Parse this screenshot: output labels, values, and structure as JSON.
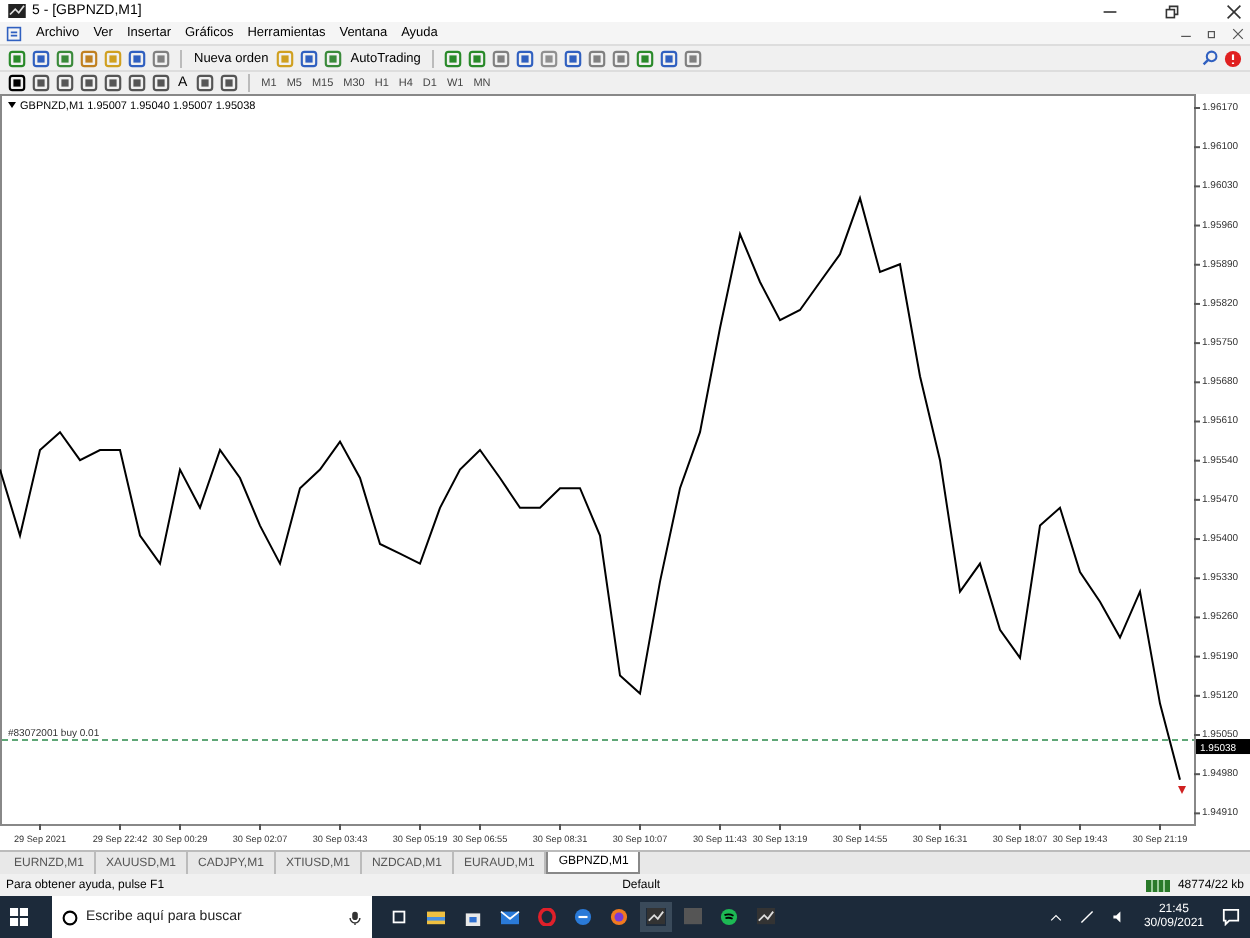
{
  "window": {
    "title": "5 - [GBPNZD,M1]"
  },
  "menu": [
    "Archivo",
    "Ver",
    "Insertar",
    "Gráficos",
    "Herramientas",
    "Ventana",
    "Ayuda"
  ],
  "toolbar": {
    "new_order": "Nueva orden",
    "autotrading": "AutoTrading",
    "text_tool": "A",
    "timeframes": [
      "M1",
      "M5",
      "M15",
      "M30",
      "H1",
      "H4",
      "D1",
      "W1",
      "MN"
    ]
  },
  "chart": {
    "header": "GBPNZD,M1  1.95007 1.95040 1.95007 1.95038",
    "price_label": "1.95038",
    "chart_data": {
      "type": "line",
      "categories": [
        null,
        null,
        "29 Sep 2021",
        null,
        null,
        null,
        "29 Sep 22:42",
        null,
        null,
        "30 Sep 00:29",
        null,
        null,
        null,
        "30 Sep 02:07",
        null,
        null,
        null,
        "30 Sep 03:43",
        null,
        null,
        null,
        "30 Sep 05:19",
        null,
        null,
        "30 Sep 06:55",
        null,
        null,
        null,
        "30 Sep 08:31",
        null,
        null,
        null,
        "30 Sep 10:07",
        null,
        null,
        null,
        "30 Sep 11:43",
        null,
        null,
        "30 Sep 13:19",
        null,
        null,
        null,
        "30 Sep 14:55",
        null,
        null,
        null,
        "30 Sep 16:31",
        null,
        null,
        null,
        "30 Sep 18:07",
        null,
        null,
        "30 Sep 19:43",
        null,
        null,
        null,
        "30 Sep 21:19",
        null
      ],
      "series": [
        {
          "color": "#000000",
          "values": [
            1.95524,
            1.95406,
            1.95559,
            1.95591,
            1.95541,
            1.95559,
            1.95559,
            1.95406,
            1.95356,
            1.95524,
            1.95456,
            1.95559,
            1.95509,
            1.95424,
            1.95356,
            1.95491,
            1.95524,
            1.95574,
            1.95509,
            1.95391,
            1.95374,
            1.95356,
            1.95456,
            1.95524,
            1.95559,
            1.95509,
            1.95456,
            1.95456,
            1.95491,
            1.95491,
            1.95406,
            1.95156,
            1.95124,
            1.95324,
            1.95491,
            1.95591,
            1.95777,
            1.95945,
            1.95859,
            1.95791,
            1.95809,
            1.95859,
            1.95909,
            1.96009,
            1.95877,
            1.95891,
            1.95691,
            1.95541,
            1.95306,
            1.95356,
            1.95238,
            1.95188,
            1.95424,
            1.95456,
            1.95341,
            1.95288,
            1.95224,
            1.95306,
            1.95106,
            1.9497
          ]
        }
      ],
      "ylim": [
        1.94891,
        1.96195
      ],
      "yticks": [
        {
          "value": 1.9617,
          "label": "1.96170"
        },
        {
          "value": 1.961,
          "label": "1.96100"
        },
        {
          "value": 1.9603,
          "label": "1.96030"
        },
        {
          "value": 1.9596,
          "label": "1.95960"
        },
        {
          "value": 1.9589,
          "label": "1.95890"
        },
        {
          "value": 1.9582,
          "label": "1.95820"
        },
        {
          "value": 1.9575,
          "label": "1.95750"
        },
        {
          "value": 1.9568,
          "label": "1.95680"
        },
        {
          "value": 1.9561,
          "label": "1.95610"
        },
        {
          "value": 1.9554,
          "label": "1.95540"
        },
        {
          "value": 1.9547,
          "label": "1.95470"
        },
        {
          "value": 1.954,
          "label": "1.95400"
        },
        {
          "value": 1.9533,
          "label": "1.95330"
        },
        {
          "value": 1.9526,
          "label": "1.95260"
        },
        {
          "value": 1.9519,
          "label": "1.95190"
        },
        {
          "value": 1.9512,
          "label": "1.95120"
        },
        {
          "value": 1.9505,
          "label": "1.95050"
        },
        {
          "value": 1.9498,
          "label": "1.94980"
        },
        {
          "value": 1.9491,
          "label": "1.94910"
        }
      ],
      "ref_lines": [
        {
          "axis": "y",
          "value": 1.95041,
          "label": "#83072001 buy 0.01",
          "color": "#2a8a4a"
        }
      ]
    }
  },
  "tabs": [
    {
      "label": "EURNZD,M1",
      "selected": false
    },
    {
      "label": "XAUUSD,M1",
      "selected": false
    },
    {
      "label": "CADJPY,M1",
      "selected": false
    },
    {
      "label": "XTIUSD,M1",
      "selected": false
    },
    {
      "label": "NZDCAD,M1",
      "selected": false
    },
    {
      "label": "EURAUD,M1",
      "selected": false
    },
    {
      "label": "GBPNZD,M1",
      "selected": true
    }
  ],
  "status_bar": {
    "help": "Para obtener ayuda, pulse F1",
    "profile": "Default",
    "traffic": "48774/22 kb"
  },
  "taskbar": {
    "search_placeholder": "Escribe aquí para buscar",
    "time": "21:45",
    "date": "30/09/2021"
  }
}
